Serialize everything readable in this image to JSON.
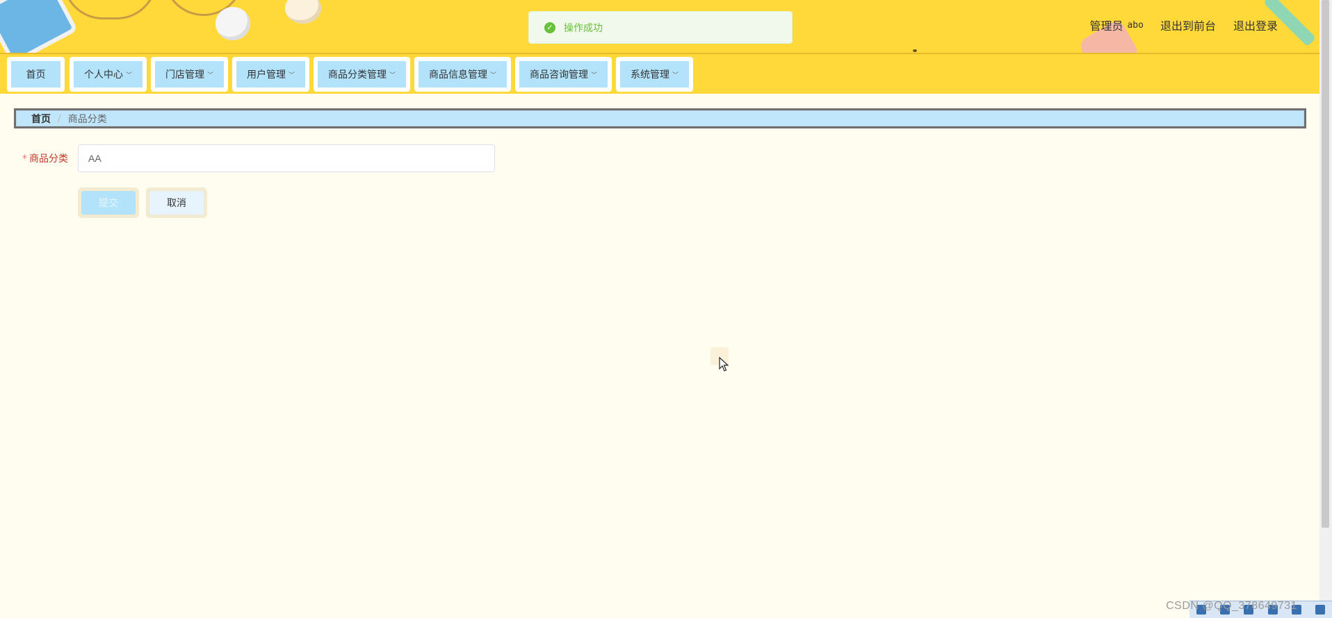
{
  "toast": {
    "text": "操作成功",
    "icon": "check-circle-icon",
    "color": "#67c23a"
  },
  "header": {
    "role": "管理员",
    "username": "abo",
    "links": [
      "退出到前台",
      "退出登录"
    ]
  },
  "nav": {
    "items": [
      {
        "label": "首页",
        "has_dropdown": false
      },
      {
        "label": "个人中心",
        "has_dropdown": true
      },
      {
        "label": "门店管理",
        "has_dropdown": true
      },
      {
        "label": "用户管理",
        "has_dropdown": true
      },
      {
        "label": "商品分类管理",
        "has_dropdown": true
      },
      {
        "label": "商品信息管理",
        "has_dropdown": true
      },
      {
        "label": "商品咨询管理",
        "has_dropdown": true
      },
      {
        "label": "系统管理",
        "has_dropdown": true
      }
    ]
  },
  "breadcrumb": {
    "home": "首页",
    "separator": "/",
    "current": "商品分类"
  },
  "form": {
    "required_mark": "*",
    "category_label": "商品分类",
    "category_value": "AA",
    "submit_label": "提交",
    "cancel_label": "取消"
  },
  "watermark": "CSDN @QQ_378649731",
  "colors": {
    "header_bg": "#ffd83a",
    "nav_button_bg": "#b3e3fb",
    "page_bg": "#fffdf0",
    "success": "#67c23a"
  }
}
